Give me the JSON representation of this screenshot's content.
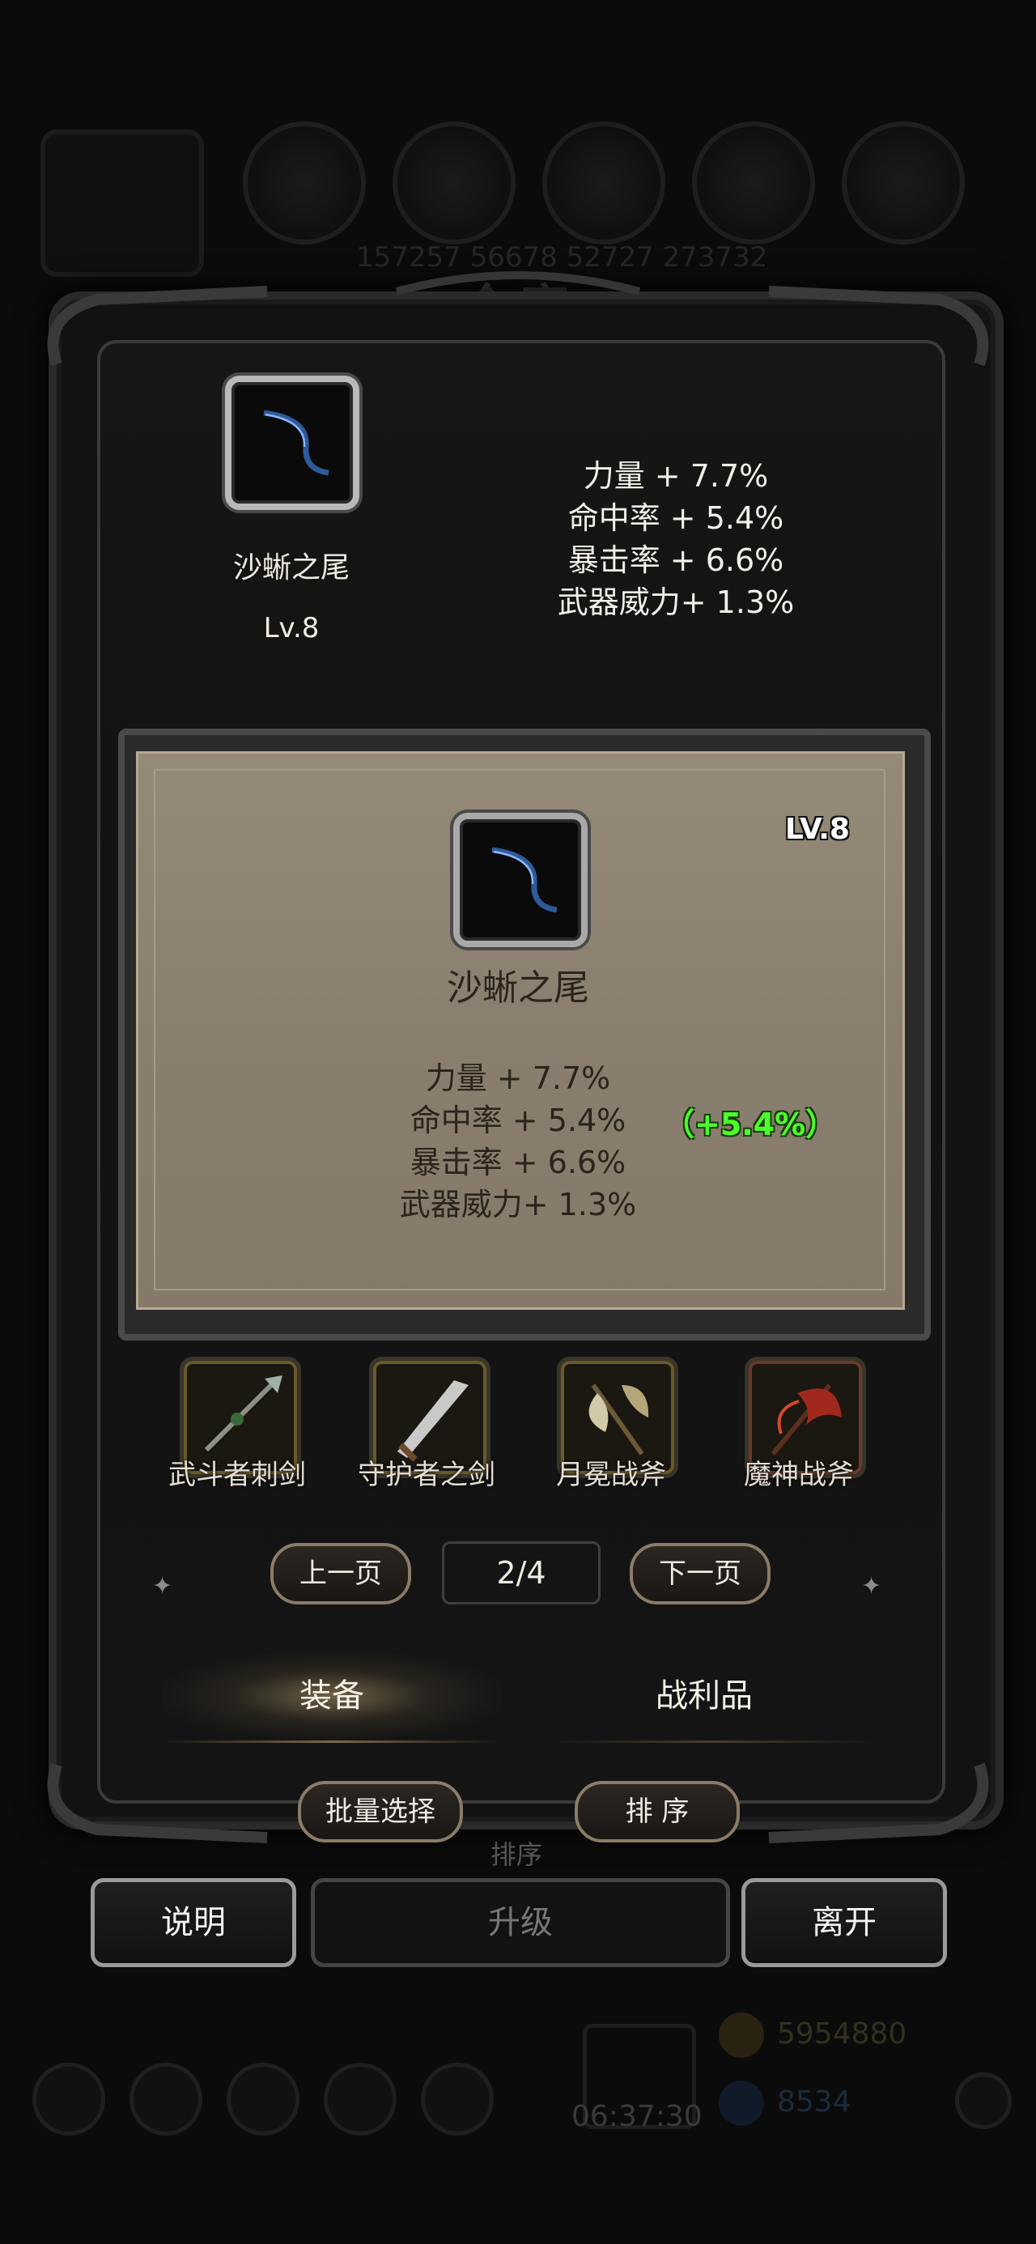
{
  "background": {
    "ghost_title": "仓库",
    "ghost_numbers": "157257  56678  52727  273732",
    "gold_amount": "5954880",
    "gem_amount": "8534",
    "timer": "06:37:30",
    "sort_ghost": "排序"
  },
  "selected_item": {
    "name": "沙蜥之尾",
    "level": "Lv.8",
    "stats": [
      "力量 + 7.7%",
      "命中率 + 5.4%",
      "暴击率 + 6.6%",
      "武器威力+ 1.3%"
    ]
  },
  "detail_card": {
    "level": "LV.8",
    "name": "沙蜥之尾",
    "stats": [
      "力量 + 7.7%",
      "命中率 + 5.4%",
      "暴击率 + 6.6%",
      "武器威力+ 1.3%"
    ],
    "bonus": "（+5.4%）",
    "bonus_color": "#4cff2a"
  },
  "weapons": [
    {
      "name": "武斗者刺剑",
      "icon": "spear-icon"
    },
    {
      "name": "守护者之剑",
      "icon": "sword-icon"
    },
    {
      "name": "月冕战斧",
      "icon": "axe-icon"
    },
    {
      "name": "魔神战斧",
      "icon": "demon-axe-icon"
    }
  ],
  "pager": {
    "prev": "上一页",
    "indicator": "2/4",
    "next": "下一页"
  },
  "tabs": {
    "equipment": "装备",
    "loot": "战利品"
  },
  "actions": {
    "batch_select": "批量选择",
    "sort": "排 序",
    "help": "说明",
    "upgrade": "升级",
    "exit": "离开"
  }
}
